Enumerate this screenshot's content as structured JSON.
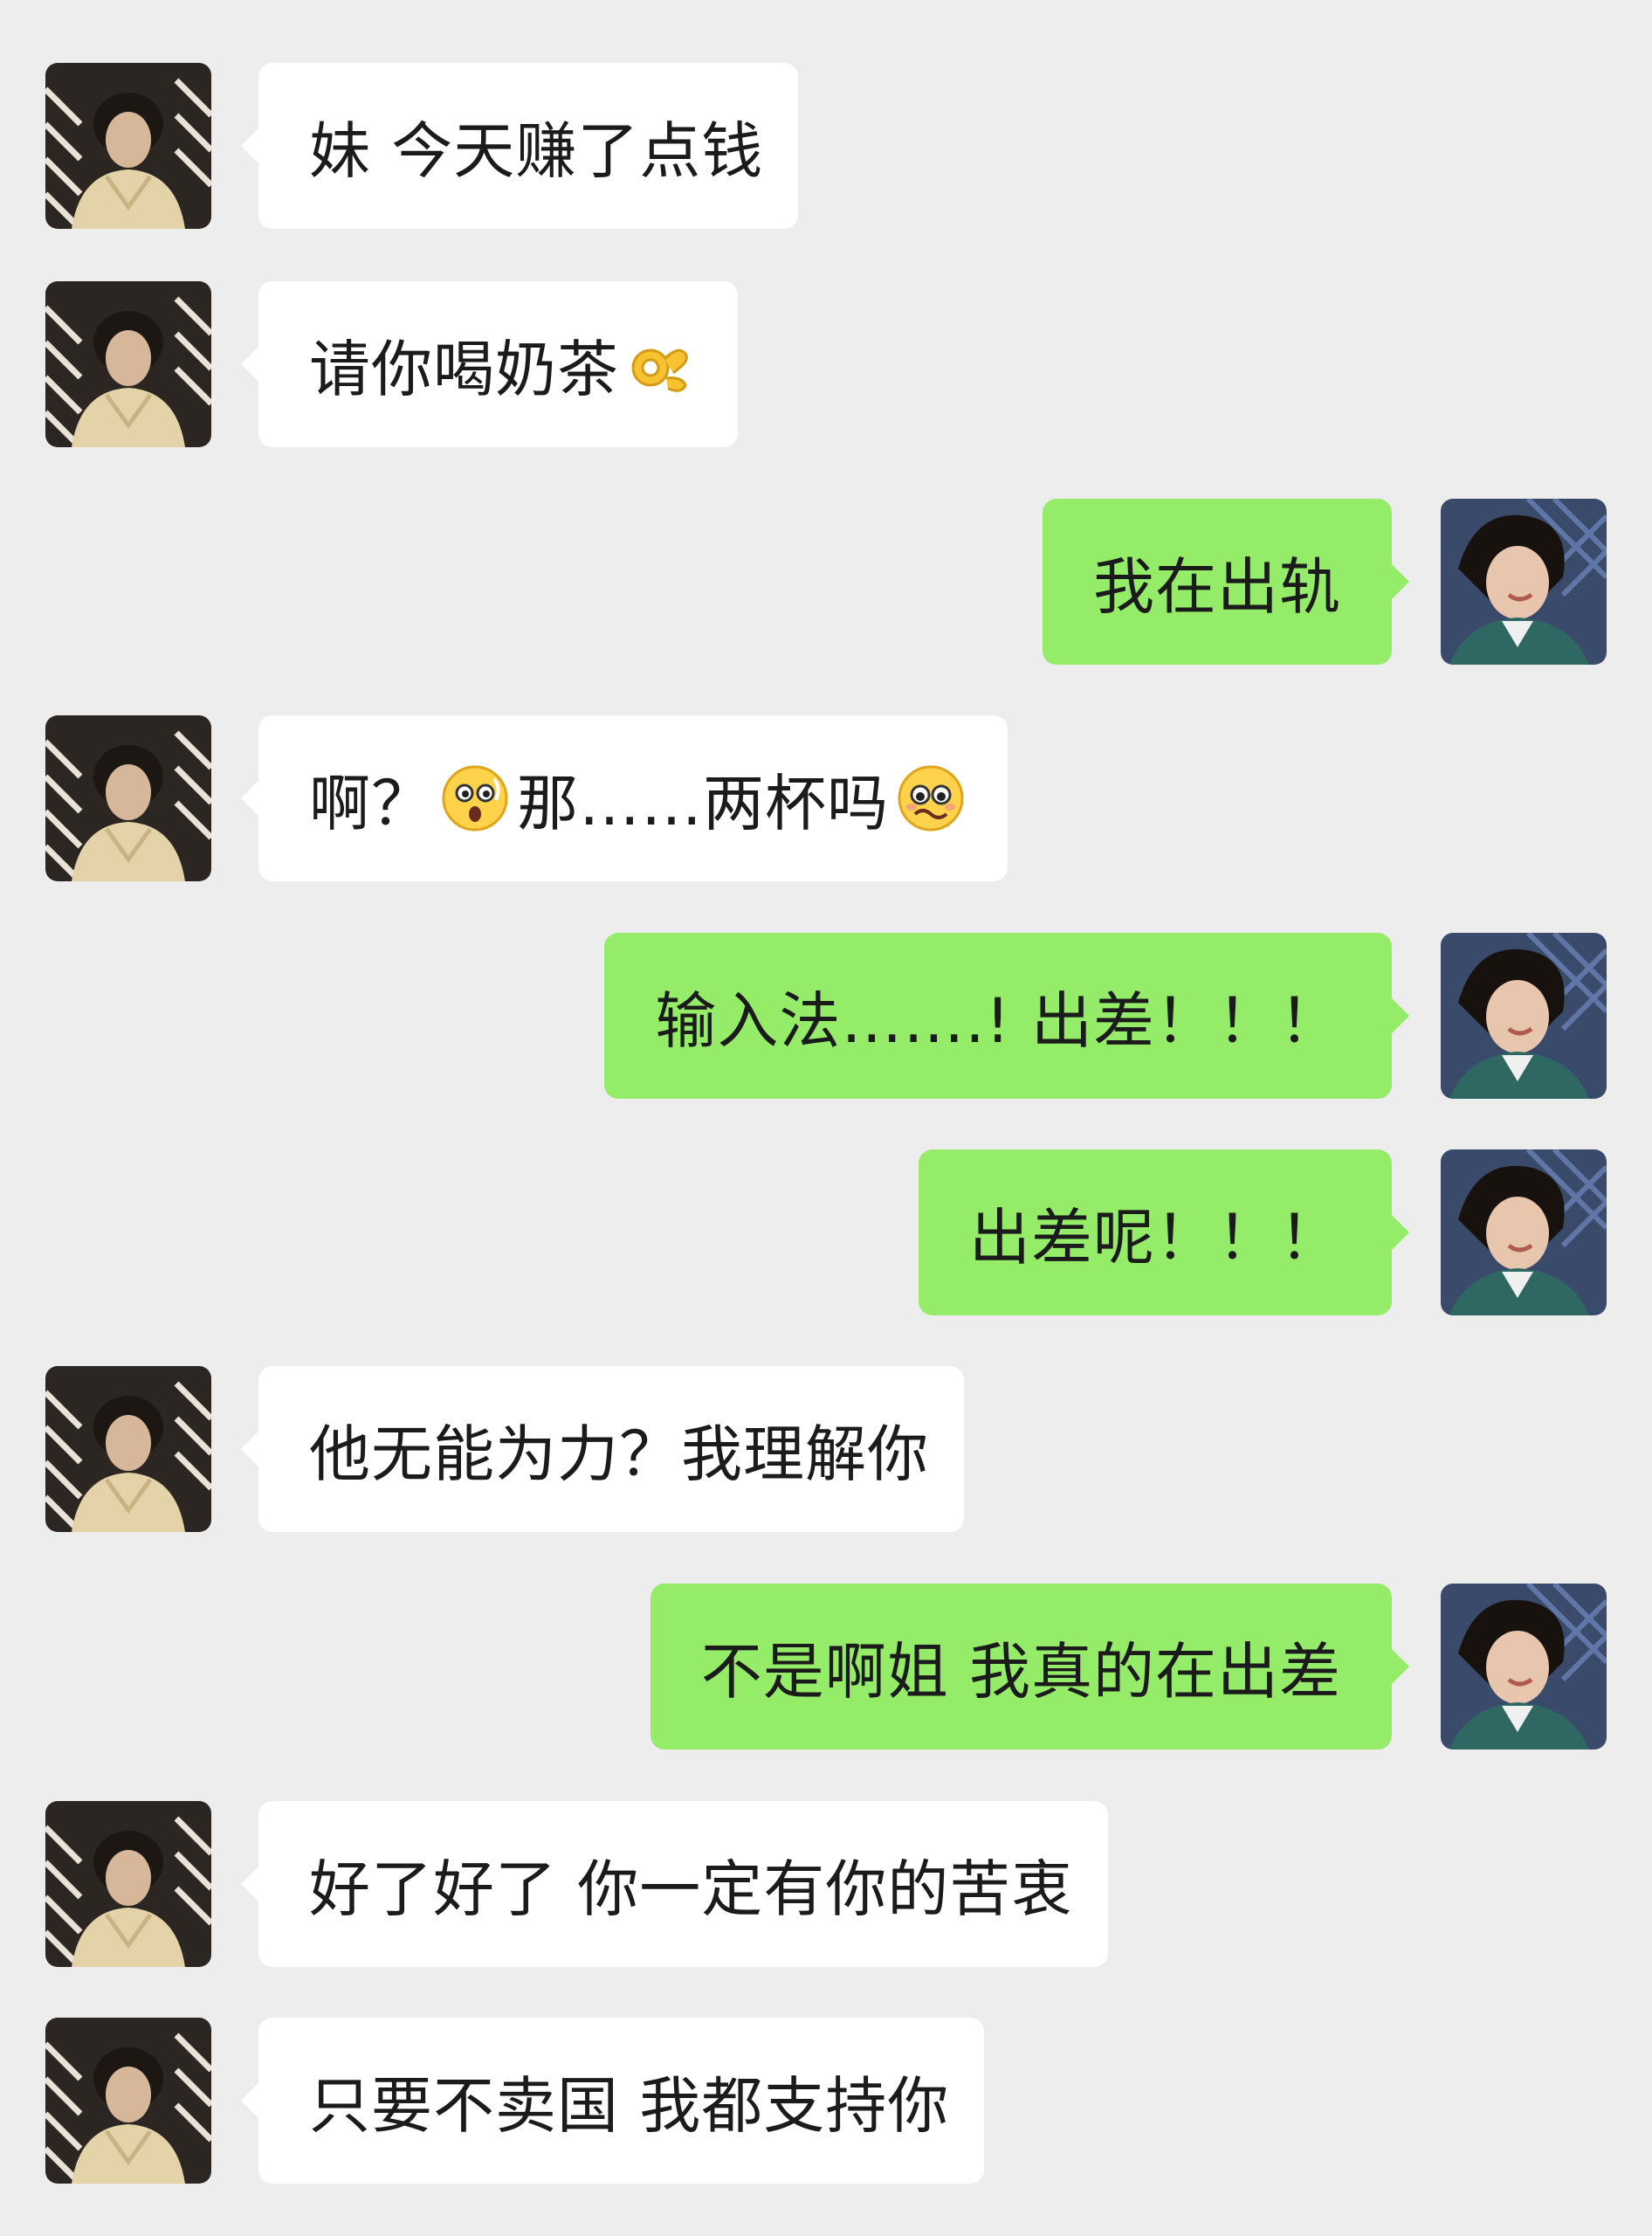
{
  "messages": [
    {
      "side": "left",
      "text": "妹 今天赚了点钱"
    },
    {
      "side": "left",
      "text": "请你喝奶茶",
      "trailing_emoji": "ok-hand-emoji"
    },
    {
      "side": "right",
      "text": "我在出轨"
    },
    {
      "side": "left",
      "parts": [
        "啊？",
        "那……两杯吗"
      ],
      "emojis": [
        "surprised-emoji",
        "pleading-face-emoji"
      ]
    },
    {
      "side": "right",
      "text": "输入法…….! 出差！！！"
    },
    {
      "side": "right",
      "text": "出差呢！！！"
    },
    {
      "side": "left",
      "text": "他无能为力？我理解你"
    },
    {
      "side": "right",
      "text": "不是啊姐 我真的在出差"
    },
    {
      "side": "left",
      "text": "好了好了 你一定有你的苦衷"
    },
    {
      "side": "left",
      "text": "只要不卖国 我都支持你"
    }
  ],
  "colors": {
    "background": "#ededed",
    "incoming_bubble": "#ffffff",
    "outgoing_bubble": "#95ec69"
  },
  "icons": {
    "incoming_avatar": "contact-avatar",
    "outgoing_avatar": "self-avatar"
  }
}
